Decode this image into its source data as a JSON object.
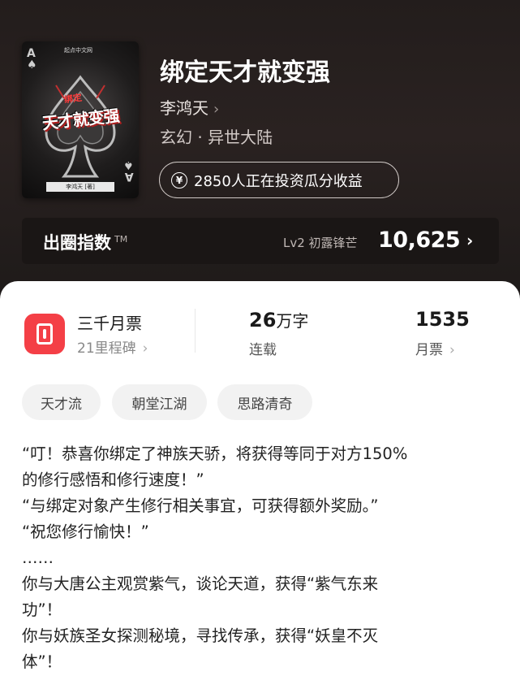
{
  "book": {
    "title": "绑定天才就变强",
    "author": "李鸿天",
    "genre": "玄幻 · 异世大陆",
    "invest_text": "2850人正在投资瓜分收益",
    "cover": {
      "badge": "起点中文网",
      "title_small": "绑定",
      "title_main": "天才就变强",
      "author_tag": "李鸿天 [著]"
    }
  },
  "index_bar": {
    "label": "出圈指数",
    "tm": "TM",
    "level": "Lv2 初露锋芒",
    "value": "10,625"
  },
  "stats": {
    "tickets_label": "三千月票",
    "tickets_sub": "21里程碑",
    "words_num": "26",
    "words_unit": "万字",
    "words_sub": "连载",
    "monthly_num": "1535",
    "monthly_sub": "月票"
  },
  "tags": [
    "天才流",
    "朝堂江湖",
    "思路清奇"
  ],
  "synopsis": [
    "“叮！恭喜你绑定了神族天骄，将获得等同于对方150%",
    "的修行感悟和修行速度！”",
    "“与绑定对象产生修行相关事宜，可获得额外奖励。”",
    "“祝您修行愉快！”",
    "……",
    "你与大唐公主观赏紫气，谈论天道，获得“紫气东来",
    "功”！",
    "你与妖族圣女探测秘境，寻找传承，获得“妖皇不灭",
    "体”！"
  ],
  "colors": {
    "hero_bg": "#231d1c",
    "accent_red": "#f43f46",
    "sheet_bg": "#ffffff"
  }
}
